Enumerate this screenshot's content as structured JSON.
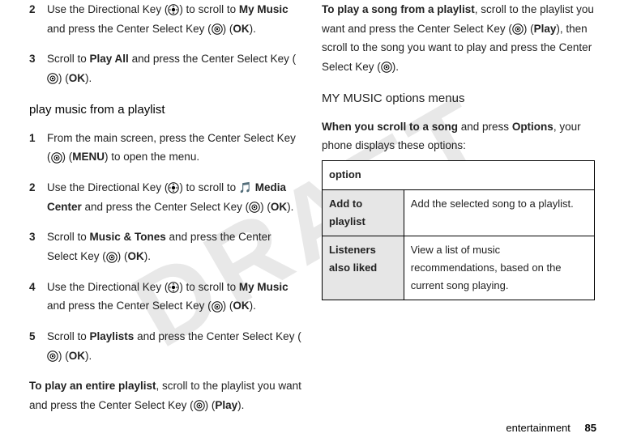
{
  "watermark": "DRAFT",
  "left": {
    "steps_top": [
      {
        "num": "2",
        "parts": [
          {
            "t": "Use the Directional Key ("
          },
          {
            "icon": "dir"
          },
          {
            "t": ") to scroll to "
          },
          {
            "t": "My Music",
            "cond": true
          },
          {
            "t": " and press the Center Select Key ("
          },
          {
            "icon": "center"
          },
          {
            "t": ") ("
          },
          {
            "t": "OK",
            "cond": true
          },
          {
            "t": ")."
          }
        ]
      },
      {
        "num": "3",
        "parts": [
          {
            "t": "Scroll to "
          },
          {
            "t": "Play All",
            "cond": true
          },
          {
            "t": " and press the Center Select Key ("
          },
          {
            "icon": "center"
          },
          {
            "t": ") ("
          },
          {
            "t": "OK",
            "cond": true
          },
          {
            "t": ")."
          }
        ]
      }
    ],
    "heading": "play music from a playlist",
    "steps_play": [
      {
        "num": "1",
        "parts": [
          {
            "t": "From the main screen, press the Center Select Key ("
          },
          {
            "icon": "center"
          },
          {
            "t": ") ("
          },
          {
            "t": "MENU",
            "cond": true
          },
          {
            "t": ") to open the menu."
          }
        ]
      },
      {
        "num": "2",
        "parts": [
          {
            "t": "Use the Directional Key ("
          },
          {
            "icon": "dir"
          },
          {
            "t": ") to scroll to "
          },
          {
            "icon": "note"
          },
          {
            "t": " "
          },
          {
            "t": "Media Center",
            "cond": true
          },
          {
            "t": " and press the Center Select Key ("
          },
          {
            "icon": "center"
          },
          {
            "t": ") ("
          },
          {
            "t": "OK",
            "cond": true
          },
          {
            "t": ")."
          }
        ]
      },
      {
        "num": "3",
        "parts": [
          {
            "t": "Scroll to "
          },
          {
            "t": "Music & Tones",
            "cond": true
          },
          {
            "t": " and press the Center Select Key ("
          },
          {
            "icon": "center"
          },
          {
            "t": ") ("
          },
          {
            "t": "OK",
            "cond": true
          },
          {
            "t": ")."
          }
        ]
      },
      {
        "num": "4",
        "parts": [
          {
            "t": "Use the Directional Key ("
          },
          {
            "icon": "dir"
          },
          {
            "t": ") to scroll to "
          },
          {
            "t": "My Music",
            "cond": true
          },
          {
            "t": " and press the Center Select Key ("
          },
          {
            "icon": "center"
          },
          {
            "t": ") ("
          },
          {
            "t": "OK",
            "cond": true
          },
          {
            "t": ")."
          }
        ]
      },
      {
        "num": "5",
        "parts": [
          {
            "t": "Scroll to "
          },
          {
            "t": "Playlists",
            "cond": true
          },
          {
            "t": " and press the Center Select Key ("
          },
          {
            "icon": "center"
          },
          {
            "t": ") ("
          },
          {
            "t": "OK",
            "cond": true
          },
          {
            "t": ")."
          }
        ]
      }
    ],
    "para_bottom": [
      {
        "t": "To play an entire playlist",
        "bold": true
      },
      {
        "t": ", scroll to the playlist you want and press the Center Select Key ("
      },
      {
        "icon": "center"
      },
      {
        "t": ") ("
      },
      {
        "t": "Play",
        "cond": true
      },
      {
        "t": ")."
      }
    ]
  },
  "right": {
    "para_top": [
      {
        "t": "To play a song from a playlist",
        "bold": true
      },
      {
        "t": ", scroll to the playlist you want and press the Center Select Key ("
      },
      {
        "icon": "center"
      },
      {
        "t": ") ("
      },
      {
        "t": "Play",
        "cond": true
      },
      {
        "t": "), then scroll to the song you want to play and press the Center Select Key ("
      },
      {
        "icon": "center"
      },
      {
        "t": ")."
      }
    ],
    "heading": "MY MUSIC options menus",
    "para_intro": [
      {
        "t": "When you scroll to a song",
        "bold": true
      },
      {
        "t": " and press "
      },
      {
        "t": "Options",
        "cond": true
      },
      {
        "t": ", your phone displays these options:"
      }
    ],
    "table": {
      "header": "option",
      "rows": [
        {
          "label": "Add to playlist",
          "desc": "Add the selected song to a playlist."
        },
        {
          "label": "Listeners also liked",
          "desc": "View a list of music recommendations, based on the current song playing."
        }
      ]
    }
  },
  "footer": {
    "section": "entertainment",
    "page": "85"
  }
}
